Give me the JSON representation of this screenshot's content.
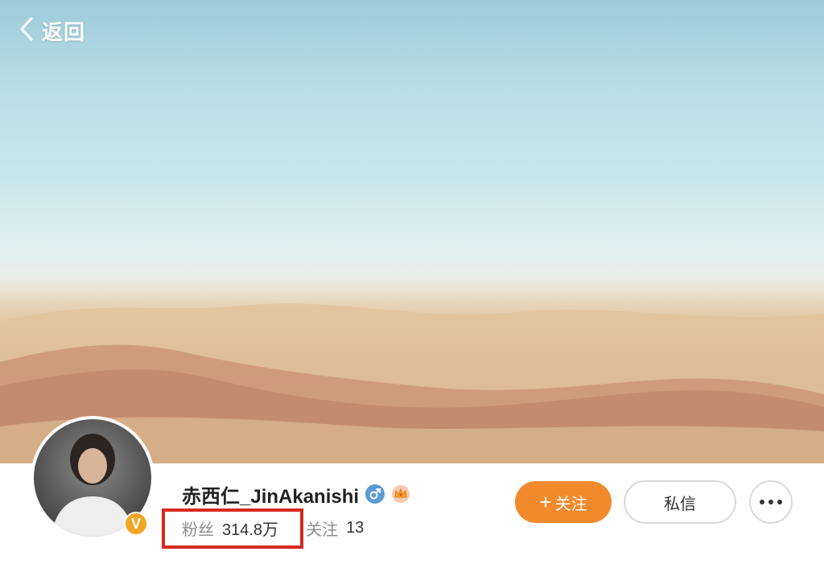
{
  "header": {
    "back_label": "返回"
  },
  "profile": {
    "name": "赤西仁_JinAkanishi",
    "verified_mark": "V",
    "gender_icon": "male-icon",
    "member_icon": "crown-icon",
    "fans_label": "粉丝",
    "fans_count": "314.8万",
    "following_label": "关注",
    "following_count": "13"
  },
  "actions": {
    "follow_label": "关注",
    "follow_prefix": "+",
    "message_label": "私信",
    "more_icon": "more-icon"
  },
  "colors": {
    "follow_accent": "#f18a2c",
    "verified_badge": "#f3a623",
    "gender_icon": "#5b9bd5",
    "highlight_box": "#d8281f"
  }
}
